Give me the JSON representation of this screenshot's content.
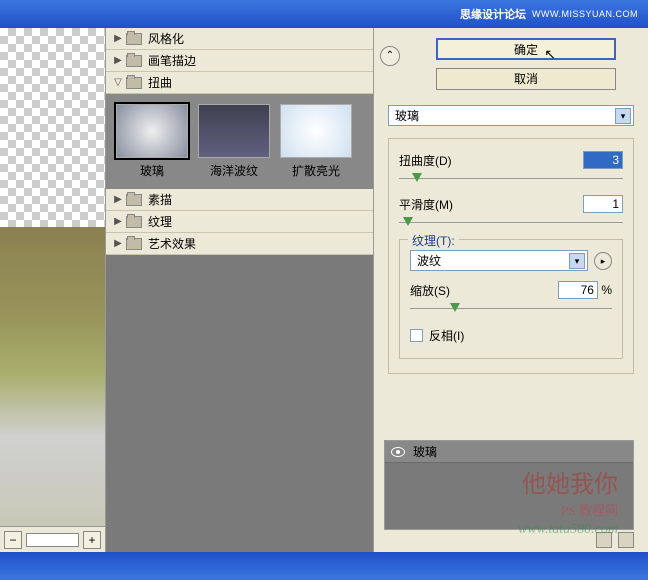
{
  "titlebar": {
    "text1": "思缘设计论坛",
    "text2": "WWW.MISSYUAN.COM"
  },
  "zoom": {
    "minus": "−",
    "level": "",
    "plus": "+"
  },
  "categories": {
    "stylize": "风格化",
    "brush": "画笔描边",
    "distort": "扭曲",
    "sketch": "素描",
    "texture": "纹理",
    "artistic": "艺术效果"
  },
  "thumbs": {
    "glass": "玻璃",
    "ocean": "海洋波纹",
    "diffuse": "扩散亮光"
  },
  "buttons": {
    "ok": "确定",
    "cancel": "取消"
  },
  "filter_dropdown": "玻璃",
  "params": {
    "distortion_label": "扭曲度(D)",
    "distortion_value": "3",
    "smoothness_label": "平滑度(M)",
    "smoothness_value": "1",
    "texture_legend": "纹理(T):",
    "texture_value": "波纹",
    "scaling_label": "缩放(S)",
    "scaling_value": "76",
    "scaling_unit": "%",
    "invert_label": "反相(I)"
  },
  "layer": {
    "name": "玻璃"
  },
  "watermark": {
    "cn": "他她我你",
    "small": "PS 教程网",
    "url": "www.tata580.com"
  }
}
